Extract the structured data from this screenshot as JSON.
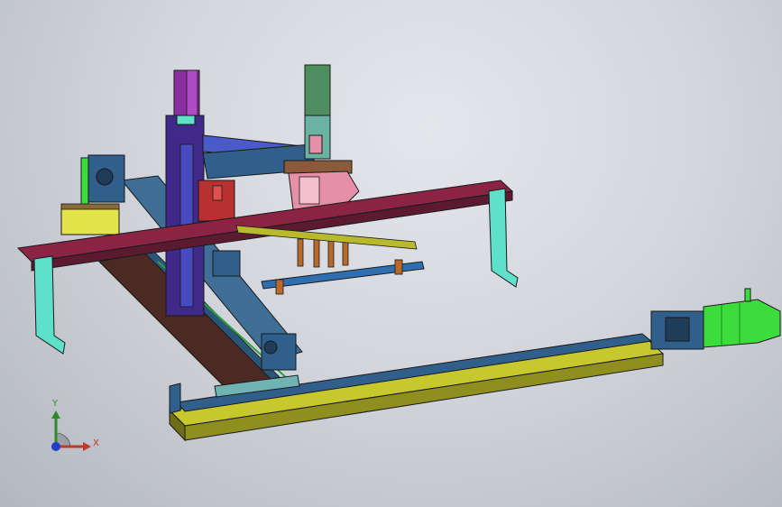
{
  "viewport": {
    "background_top": "#e4e6eb",
    "background_bottom": "#b3b7bf"
  },
  "model": {
    "parts": [
      "base-rail-long",
      "motor",
      "gantry-crossbeam",
      "gantry-legs",
      "vertical-column",
      "carriage-block",
      "gripper-head",
      "rear-beam",
      "fixture-block",
      "suction-bar"
    ],
    "colors": {
      "rail_yellow": "#b9b92d",
      "rail_blue": "#2f5f8a",
      "crossbeam": "#8a2344",
      "legs_cyan": "#5fe0c8",
      "motor_green": "#3ddc3d",
      "column_purple": "#8a2fa0",
      "carriage_pink": "#e58fa8",
      "rear_beam_brown": "#4a2a22",
      "fixture_green": "#3c8c5a",
      "block_yellow": "#e3e34a"
    }
  },
  "triad": {
    "x_label": "X",
    "y_label": "Y"
  }
}
